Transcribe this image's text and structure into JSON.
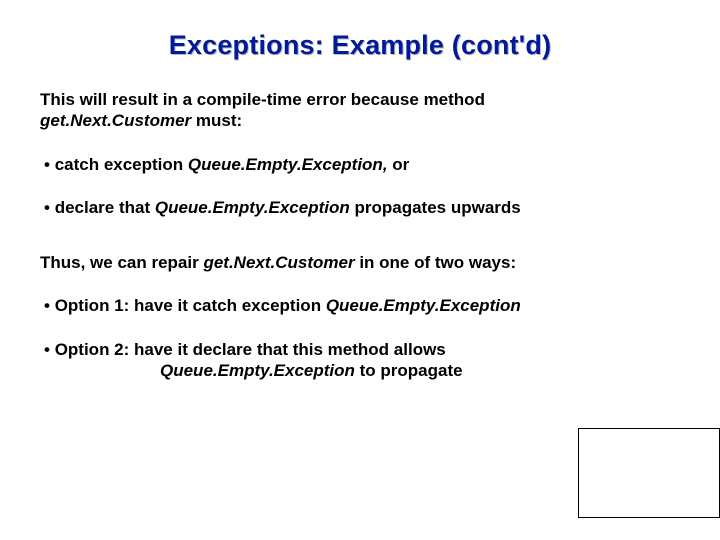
{
  "title": "Exceptions: Example (cont'd)",
  "intro_line1": "This will result in a compile-time error because method ",
  "intro_method": "get.Next.Customer",
  "intro_line2": " must:",
  "b1_pre": "catch exception ",
  "b1_exc": "Queue.Empty.Exception,",
  "b1_post": " or",
  "b2_pre": "declare that ",
  "b2_exc": "Queue.Empty.Exception",
  "b2_post": " propagates upwards",
  "repair_pre": "Thus, we can repair ",
  "repair_method": "get.Next.Customer",
  "repair_post": " in one of two ways:",
  "opt1_pre": "Option 1: have it catch exception ",
  "opt1_exc": "Queue.Empty.Exception",
  "opt2_line1": "Option 2: have it declare that this method allows",
  "opt2_exc": "Queue.Empty.Exception",
  "opt2_post": " to propagate"
}
